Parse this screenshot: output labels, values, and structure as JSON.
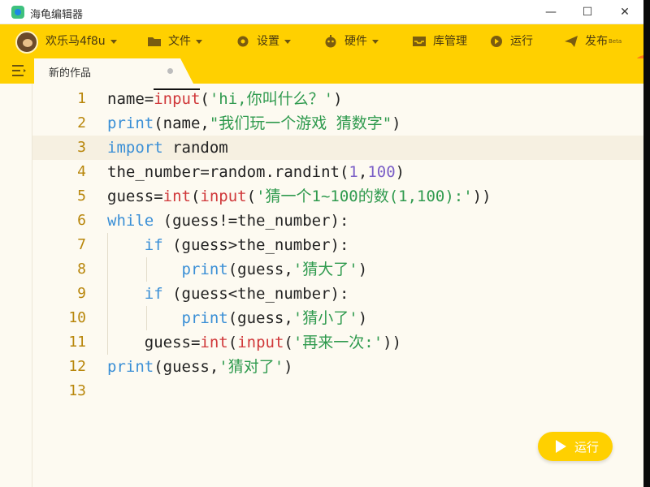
{
  "window": {
    "title": "海龟编辑器",
    "minimize": "—",
    "maximize": "☐",
    "close": "✕"
  },
  "menubar": {
    "user": "欢乐马4f8u",
    "file": "文件",
    "settings": "设置",
    "hardware": "硬件",
    "library": "库管理",
    "run": "运行",
    "publish": "发布",
    "publish_badge": "Beta"
  },
  "tabs": [
    {
      "label": "新的作品"
    }
  ],
  "editor": {
    "current_line": 3,
    "lines": [
      {
        "n": "1"
      },
      {
        "n": "2"
      },
      {
        "n": "3"
      },
      {
        "n": "4"
      },
      {
        "n": "5"
      },
      {
        "n": "6"
      },
      {
        "n": "7"
      },
      {
        "n": "8"
      },
      {
        "n": "9"
      },
      {
        "n": "10"
      },
      {
        "n": "11"
      },
      {
        "n": "12"
      },
      {
        "n": "13"
      }
    ],
    "tokens": {
      "name": "name=",
      "input": "input",
      "hi": "'hi,你叫什么？'",
      "print": "print",
      "game": "\"我们玩一个游戏 猜数字\"",
      "import": "import",
      "random": " random",
      "the_number_assign": "the_number=random.randint(",
      "one": "1",
      "hundred": "100",
      "guess_assign": "guess=",
      "int": "int",
      "guess_prompt": "'猜一个1~100的数(1,100):'",
      "while": "while",
      "cond_ne": " (guess!=the_number):",
      "if": "if",
      "cond_gt": " (guess>the_number):",
      "cond_lt": " (guess<the_number):",
      "guess_comma": "(guess,",
      "too_big": "'猜大了'",
      "too_small": "'猜小了'",
      "again": "'再来一次:'",
      "correct": "'猜对了'",
      "name_comma": "(name,"
    }
  },
  "run_button": {
    "label": "运行"
  },
  "colors": {
    "accent": "#ffd000",
    "keyword": "#3a8fd6",
    "builtin": "#d0383a",
    "string": "#2f9a4e",
    "number": "#7b5fc7",
    "line_number": "#b8860b"
  }
}
